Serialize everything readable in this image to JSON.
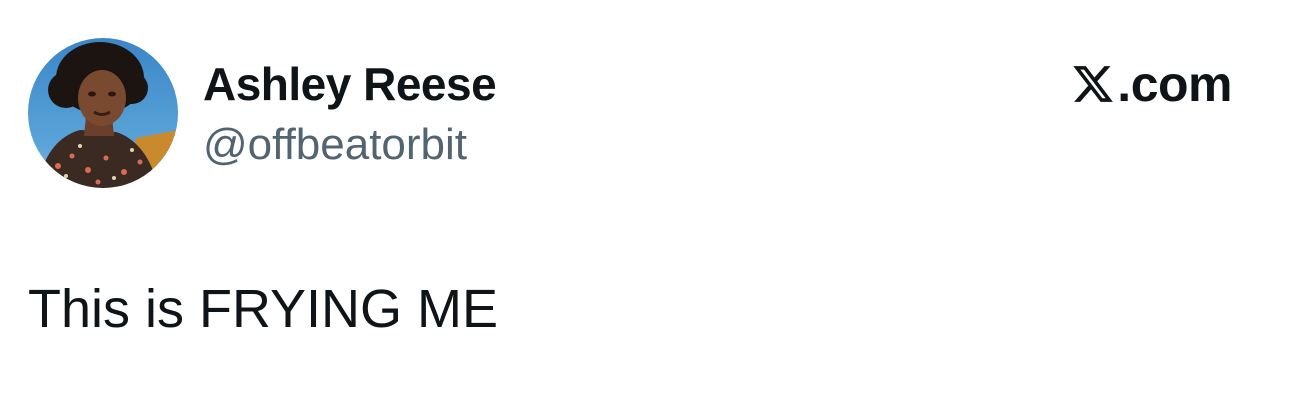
{
  "author": {
    "display_name": "Ashley Reese",
    "handle": "@offbeatorbit",
    "avatar_icon": "profile-photo"
  },
  "brand": {
    "icon": "x-logo-icon",
    "domain_suffix": ".com"
  },
  "tweet": {
    "text": "This is FRYING ME"
  },
  "colors": {
    "text_primary": "#0f1419",
    "text_secondary": "#536471",
    "background": "#ffffff"
  }
}
